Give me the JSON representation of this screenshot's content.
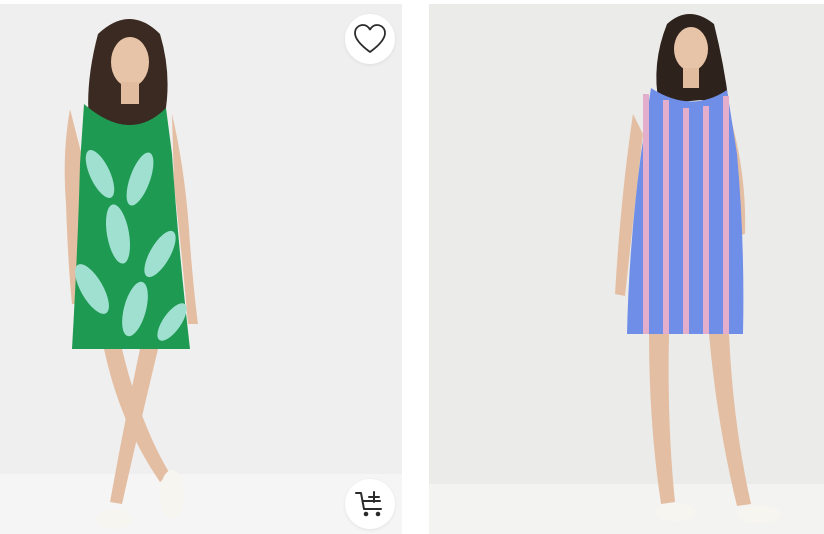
{
  "products": [
    {
      "image_icon": "green-palm-leaf-print-dress-photo",
      "actions": {
        "wishlist_icon": "heart-outline-icon",
        "add_to_cart_icon": "cart-plus-icon"
      }
    },
    {
      "image_icon": "blue-striped-sleeveless-dress-photo"
    }
  ],
  "colors": {
    "dress_green": "#1f9a52",
    "leaf_mint": "#9fe0d0",
    "stripe_blue": "#6f8ee8",
    "stripe_pink": "#e2aecb",
    "icon_dark": "#2b2b2b"
  }
}
